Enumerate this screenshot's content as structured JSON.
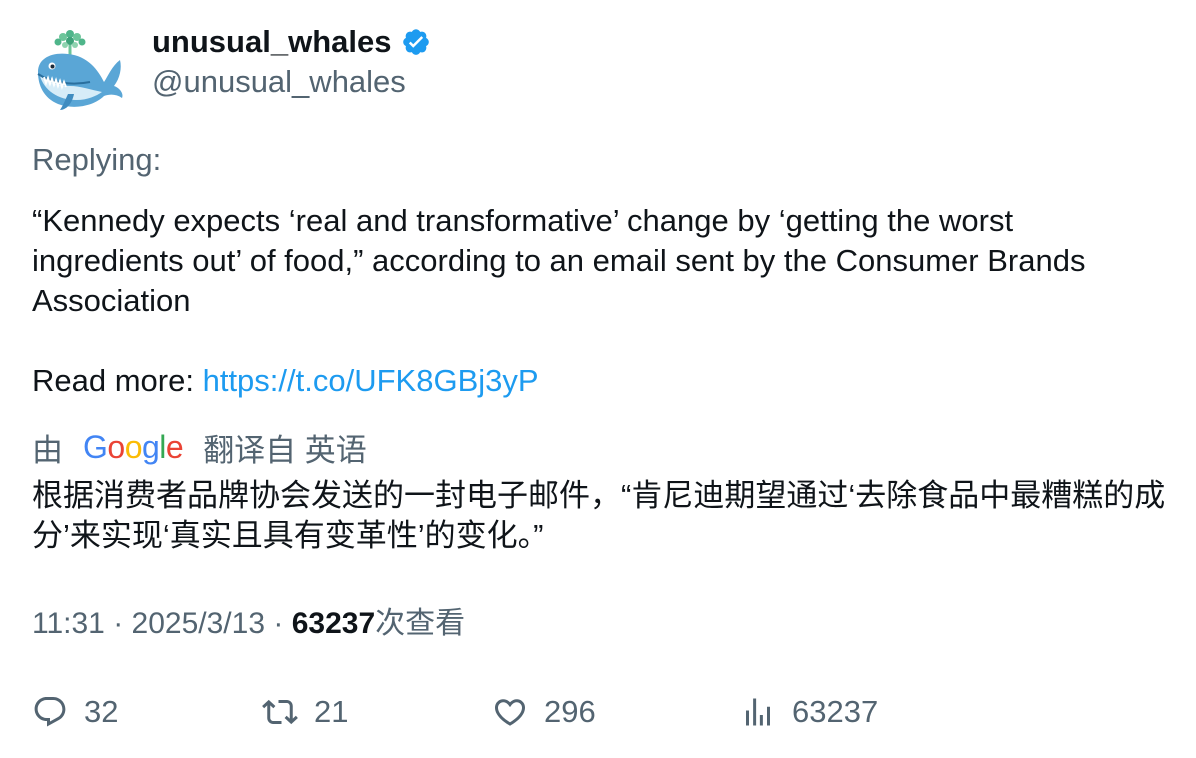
{
  "author": {
    "display_name": "unusual_whales",
    "handle": "@unusual_whales",
    "verified": true,
    "avatar_icon": "whale-logo-icon"
  },
  "tweet": {
    "replying_label": "Replying:",
    "body": "“Kennedy expects ‘real and transformative’ change by ‘getting the worst ingredients out’ of food,” according to an email sent by the Consumer Brands Association",
    "read_more_label": "Read more:",
    "link": "https://t.co/UFK8GBj3yP"
  },
  "translation": {
    "by_label": "由",
    "provider": "Google",
    "from_label": "翻译自 英语",
    "text": "根据消费者品牌协会发送的一封电子邮件，“肯尼迪期望通过‘去除食品中最糟糕的成分’来实现‘真实且具有变革性’的变化。”"
  },
  "meta": {
    "time": "11:31",
    "separator": "·",
    "date": "2025/3/13",
    "views_count": "63237",
    "views_label": "次查看"
  },
  "actions": {
    "replies": "32",
    "reposts": "21",
    "likes": "296",
    "views": "63237"
  },
  "colors": {
    "text_primary": "#0f1419",
    "text_secondary": "#536471",
    "link": "#1d9bf0",
    "verified_badge": "#1d9bf0"
  }
}
